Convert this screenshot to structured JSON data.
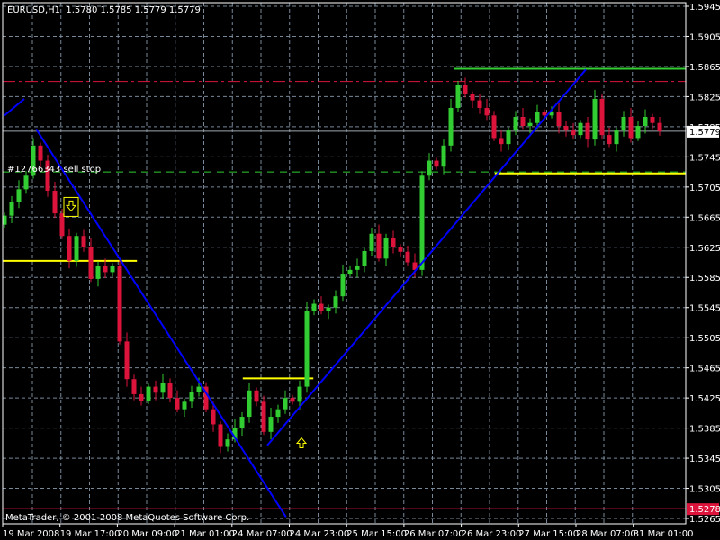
{
  "header": {
    "symbol_info": "EURUSD,H1  1.5780 1.5785 1.5779 1.5779"
  },
  "copyright": "MetaTrader, © 2001-2008 MetaQuotes Software Corp.",
  "order_label": "#12766343 sell stop",
  "colors": {
    "background": "#000000",
    "grid": "#778899",
    "bull": "#32CD32",
    "bear": "#DC143C",
    "trend": "#0000FF",
    "level": "#FFFF00",
    "green_level": "#32CD32",
    "red_level": "#DC143C",
    "axis": "#FFFFFF"
  },
  "chart_data": {
    "type": "candlestick",
    "title": "EURUSD,H1",
    "ylim": [
      1.5265,
      1.5945
    ],
    "price_ticks": [
      "1.5945",
      "1.5905",
      "1.5865",
      "1.5825",
      "1.5785",
      "1.5745",
      "1.5705",
      "1.5665",
      "1.5625",
      "1.5585",
      "1.5545",
      "1.5505",
      "1.5465",
      "1.5425",
      "1.5385",
      "1.5345",
      "1.5305",
      "1.5265"
    ],
    "time_ticks": [
      "19 Mar 2008",
      "19 Mar 17:00",
      "20 Mar 09:00",
      "21 Mar 01:00",
      "24 Mar 07:00",
      "24 Mar 23:00",
      "25 Mar 15:00",
      "26 Mar 07:00",
      "26 Mar 23:00",
      "27 Mar 15:00",
      "28 Mar 07:00",
      "31 Mar 01:00"
    ],
    "current_price": "1.5779",
    "red_level_price": "1.5278",
    "closes": [
      1.5667,
      1.5685,
      1.5702,
      1.572,
      1.576,
      1.574,
      1.57,
      1.567,
      1.564,
      1.5607,
      1.564,
      1.5625,
      1.5583,
      1.56,
      1.5592,
      1.56,
      1.55,
      1.545,
      1.543,
      1.5421,
      1.544,
      1.5432,
      1.5445,
      1.5425,
      1.541,
      1.542,
      1.5433,
      1.544,
      1.541,
      1.539,
      1.536,
      1.537,
      1.5385,
      1.54,
      1.5435,
      1.542,
      1.538,
      1.54,
      1.541,
      1.5425,
      1.542,
      1.544,
      1.5541,
      1.555,
      1.554,
      1.5545,
      1.556,
      1.559,
      1.5595,
      1.56,
      1.562,
      1.5643,
      1.561,
      1.5637,
      1.5625,
      1.5619,
      1.5605,
      1.5595,
      1.572,
      1.574,
      1.5732,
      1.576,
      1.581,
      1.584,
      1.5828,
      1.582,
      1.581,
      1.58,
      1.577,
      1.5762,
      1.578,
      1.5798,
      1.5786,
      1.579,
      1.5804,
      1.58,
      1.5804,
      1.5786,
      1.578,
      1.5774,
      1.579,
      1.5768,
      1.5822,
      1.5774,
      1.5762,
      1.578,
      1.5798,
      1.577,
      1.5786,
      1.5798,
      1.579,
      1.5779
    ],
    "first_open": 1.5655,
    "trendlines": [
      {
        "name": "trendline-1",
        "i1": 0,
        "p1": 1.58,
        "i2": 2.75,
        "p2": 1.5822
      },
      {
        "name": "trendline-down",
        "i1": 4.4,
        "p1": 1.5782,
        "i2": 39.1,
        "p2": 1.5267
      },
      {
        "name": "trendline-up",
        "i1": 36.5,
        "p1": 1.5362,
        "i2": 80.75,
        "p2": 1.5861
      }
    ],
    "hlines": [
      {
        "name": "resistance-green",
        "price": 1.5862,
        "i1": 62.5,
        "i2": null,
        "color": "green_level",
        "dash": false
      },
      {
        "name": "yellow-level-1",
        "price": 1.5607,
        "i1": -0.25,
        "i2": 18.4,
        "color": "level",
        "dash": false
      },
      {
        "name": "yellow-level-2",
        "price": 1.5451,
        "i1": 33.1,
        "i2": 42.9,
        "color": "level",
        "dash": false
      },
      {
        "name": "yellow-level-3",
        "price": 1.5723,
        "i1": 68.1,
        "i2": null,
        "color": "level",
        "dash": false
      },
      {
        "name": "sell-stop-line",
        "price": 1.5725,
        "i1": null,
        "i2": null,
        "color": "green_level",
        "dash": true
      },
      {
        "name": "red-dashed-level",
        "price": 1.5845,
        "i1": null,
        "i2": null,
        "color": "red_level",
        "dash": "dashdot"
      },
      {
        "name": "red-level",
        "price": 1.5278,
        "i1": null,
        "i2": null,
        "color": "red_level",
        "dash": false
      }
    ],
    "arrows": [
      {
        "name": "sell-arrow-icon",
        "dir": "down",
        "i": 9.25,
        "price": 1.5678
      },
      {
        "name": "buy-arrow-icon",
        "dir": "up",
        "i": 41.25,
        "price": 1.5366
      }
    ]
  }
}
